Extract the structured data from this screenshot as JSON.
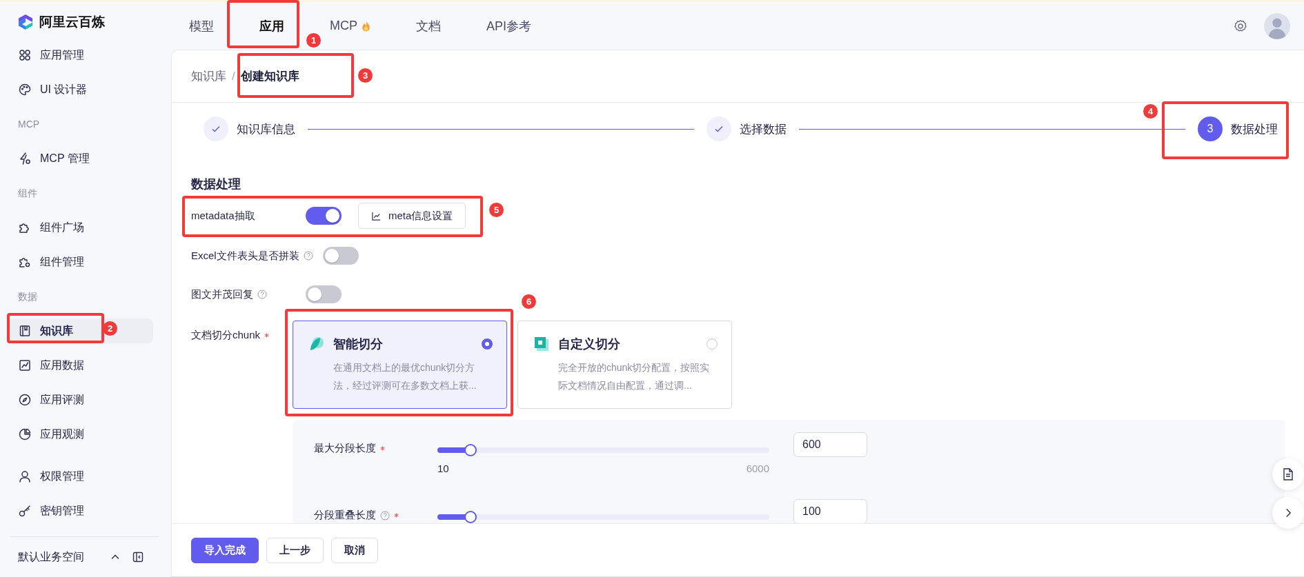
{
  "brand": {
    "name": "阿里云百炼"
  },
  "nav": [
    {
      "label": "模型",
      "selected": false,
      "hot": false
    },
    {
      "label": "应用",
      "selected": true,
      "hot": false
    },
    {
      "label": "MCP",
      "selected": false,
      "hot": true
    },
    {
      "label": "文档",
      "selected": false,
      "hot": false
    },
    {
      "label": "API参考",
      "selected": false,
      "hot": false
    }
  ],
  "sidebar": {
    "items": [
      {
        "kind": "item",
        "label": "应用管理",
        "selected": false
      },
      {
        "kind": "item",
        "label": "UI 设计器",
        "selected": false
      },
      {
        "kind": "section",
        "label": "MCP"
      },
      {
        "kind": "item",
        "label": "MCP 管理",
        "selected": false
      },
      {
        "kind": "section",
        "label": "组件"
      },
      {
        "kind": "item",
        "label": "组件广场",
        "selected": false
      },
      {
        "kind": "item",
        "label": "组件管理",
        "selected": false
      },
      {
        "kind": "section",
        "label": "数据"
      },
      {
        "kind": "item",
        "label": "知识库",
        "selected": true
      },
      {
        "kind": "item",
        "label": "应用数据",
        "selected": false
      },
      {
        "kind": "item",
        "label": "应用评测",
        "selected": false
      },
      {
        "kind": "item",
        "label": "应用观测",
        "selected": false
      }
    ],
    "bottom_items": [
      {
        "label": "权限管理",
        "selected": false
      },
      {
        "label": "密钥管理",
        "selected": false
      }
    ],
    "workspace": "默认业务空间"
  },
  "breadcrumb": {
    "separator": "/",
    "items": [
      {
        "label": "知识库",
        "current": false
      },
      {
        "label": "创建知识库",
        "current": true
      }
    ]
  },
  "steps": [
    {
      "label": "知识库信息",
      "done": true
    },
    {
      "label": "选择数据",
      "done": true
    },
    {
      "label": "数据处理",
      "number": "3",
      "done": false
    }
  ],
  "form": {
    "title": "数据处理",
    "rows": [
      {
        "label": "metadata抽取",
        "on": true,
        "button": "meta信息设置"
      },
      {
        "label": "Excel文件表头是否拼装",
        "help": true,
        "on": false
      },
      {
        "label": "图文并茂回复",
        "help": true,
        "on": false
      }
    ],
    "chunk": {
      "label": "文档切分chunk",
      "required": true,
      "options": [
        {
          "kind": "smart",
          "title": "智能切分",
          "description": "在通用文档上的最优chunk切分方法，经过评测可在多数文档上获...",
          "selected": true
        },
        {
          "kind": "custom",
          "title": "自定义切分",
          "description": "完全开放的chunk切分配置，按照实际文档情况自由配置，通过调...",
          "selected": false
        }
      ]
    },
    "sliders": [
      {
        "label": "最大分段长度",
        "required": true,
        "level": 0.1,
        "min": "10",
        "max": "6000",
        "value": "600"
      },
      {
        "label": "分段重叠长度",
        "help": true,
        "required": true,
        "level": 0.1,
        "value": "100"
      }
    ]
  },
  "footer": {
    "buttons": [
      {
        "label": "导入完成",
        "kind": "primary"
      },
      {
        "label": "上一步",
        "kind": "default"
      },
      {
        "label": "取消",
        "kind": "default"
      }
    ]
  },
  "annotations": [
    {
      "number": "1"
    },
    {
      "number": "2"
    },
    {
      "number": "3"
    },
    {
      "number": "4"
    },
    {
      "number": "5"
    },
    {
      "number": "6"
    }
  ]
}
